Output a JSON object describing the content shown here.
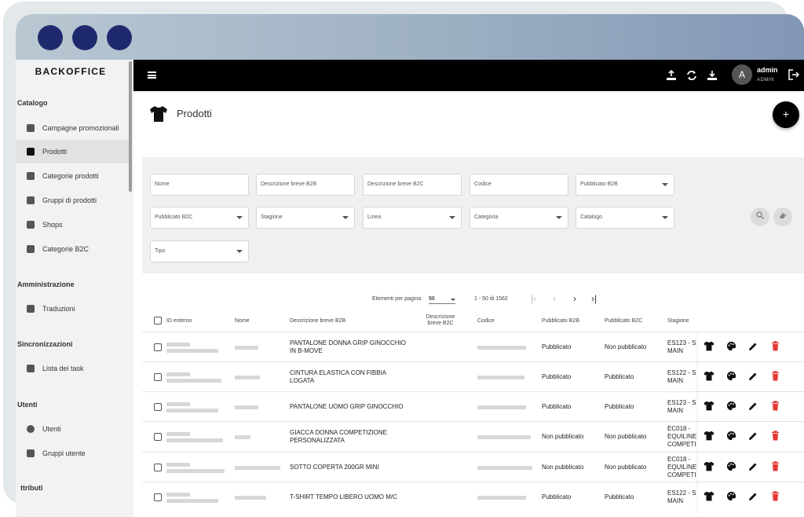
{
  "sidebar": {
    "brand": "BACKOFFICE",
    "sections": [
      {
        "title": "Catalogo",
        "items": [
          "Campagne promozionali",
          "Prodotti",
          "Categorie prodotti",
          "Gruppi di prodotti",
          "Shops",
          "Categorie B2C"
        ]
      },
      {
        "title": "Amministrazione",
        "items": [
          "Traduzioni"
        ]
      },
      {
        "title": "Sincronizzazioni",
        "items": [
          "Lista dei task"
        ]
      },
      {
        "title": "Utenti",
        "items": [
          "Utenti",
          "Gruppi utente"
        ]
      },
      {
        "title": "ttributi",
        "items": []
      }
    ]
  },
  "header": {
    "user_initial": "A",
    "user_name": "admin",
    "user_role": "ADMIN"
  },
  "page": {
    "title": "Prodotti",
    "add_label": "+"
  },
  "filters": {
    "row1": [
      "Nome",
      "Descrizione breve B2B",
      "Descrizione breve B2C",
      "Codice",
      "Pubblicato B2B"
    ],
    "row2": [
      "Pubblicato B2C",
      "Stagione",
      "Linea",
      "Categoria",
      "Catalogo"
    ],
    "row3": [
      "Tipo"
    ]
  },
  "pager": {
    "label": "Elementi per pagina",
    "per_page": "50",
    "range": "1 - 50 di 1562"
  },
  "table": {
    "columns": [
      "ID esterno",
      "Nome",
      "Descrizione breve B2B",
      "Descrizione breve B2C",
      "Codice",
      "Pubblicato B2B",
      "Pubblicato B2C",
      "Stagione"
    ],
    "rows": [
      {
        "desc": "PANTALONE DONNA GRIP GINOCCHIO IN B-MOVE",
        "b2b": "Pubblicato",
        "b2c": "Non pubblicato",
        "season": "ES123 - S\nMAIN"
      },
      {
        "desc": "CINTURA ELASTICA CON FIBBIA LOGATA",
        "b2b": "Pubblicato",
        "b2c": "Pubblicato",
        "season": "ES122 - S\nMAIN"
      },
      {
        "desc": "PANTALONE UOMO GRIP GINOCCHIO",
        "b2b": "Pubblicato",
        "b2c": "Pubblicato",
        "season": "ES123 - S\nMAIN"
      },
      {
        "desc": "GIACCA DONNA COMPETIZIONE PERSONALIZZATA",
        "b2b": "Non pubblicato",
        "b2c": "Non pubblicato",
        "season": "EC018 -\nEQUILINE\nCOMPETI"
      },
      {
        "desc": "SOTTO COPERTA 200GR MINI",
        "b2b": "Non pubblicato",
        "b2c": "Non pubblicato",
        "season": "EC018 -\nEQUILINE\nCOMPETI"
      },
      {
        "desc": "T-SHIRT TEMPO LIBERO UOMO M/C",
        "b2b": "Pubblicato",
        "b2c": "Pubblicato",
        "season": "ES122 - S\nMAIN"
      }
    ]
  },
  "colors": {
    "brand_dot": "#1f2a6e",
    "delete_red": "#e53935"
  }
}
